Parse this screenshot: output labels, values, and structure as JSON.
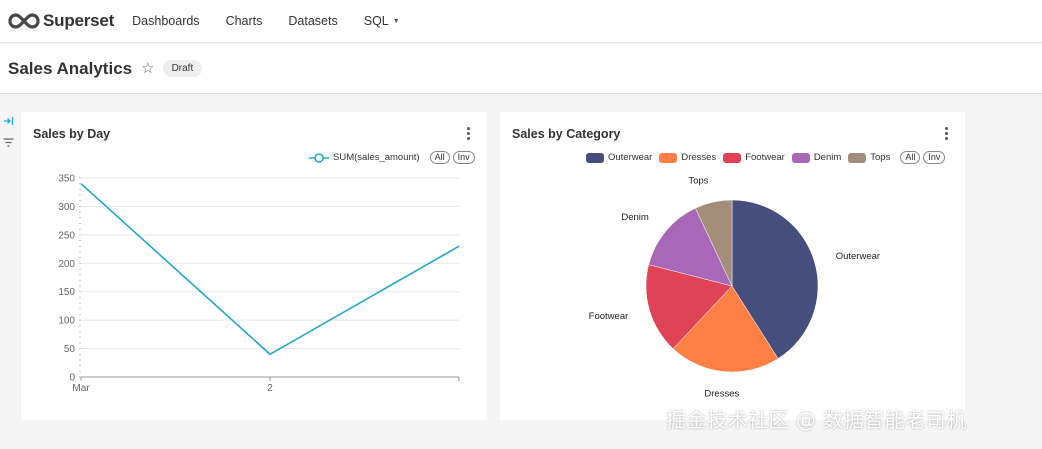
{
  "app": {
    "brand": "Superset"
  },
  "nav": {
    "items": [
      "Dashboards",
      "Charts",
      "Datasets",
      "SQL"
    ]
  },
  "header": {
    "title": "Sales Analytics",
    "status": "Draft"
  },
  "colors": {
    "line": "#1fa8c9",
    "outerwear": "#454e7c",
    "dresses": "#ff7f44",
    "footwear": "#e04355",
    "denim": "#a868b7",
    "tops": "#a38f79",
    "brand": "#484848"
  },
  "charts": [
    {
      "title": "Sales by Day",
      "legend": {
        "series": "SUM(sales_amount)",
        "all": "All",
        "inv": "Inv"
      },
      "icons": [
        "menu-icon"
      ]
    },
    {
      "title": "Sales by Category",
      "legend": {
        "all": "All",
        "inv": "Inv"
      },
      "icons": [
        "menu-icon"
      ]
    }
  ],
  "chart_data": [
    {
      "type": "line",
      "title": "Sales by Day",
      "categories": [
        "Mar",
        "2",
        ""
      ],
      "series": [
        {
          "name": "SUM(sales_amount)",
          "values": [
            340,
            40,
            230
          ]
        }
      ],
      "yticks": [
        0,
        50,
        100,
        150,
        200,
        250,
        300,
        350
      ],
      "ylim": [
        0,
        350
      ],
      "grid": true,
      "legend": "top-right"
    },
    {
      "type": "pie",
      "title": "Sales by Category",
      "categories": [
        "Outerwear",
        "Dresses",
        "Footwear",
        "Denim",
        "Tops"
      ],
      "values": [
        41,
        21,
        17,
        14,
        7
      ],
      "legend": "top"
    }
  ],
  "watermark": "掘金技术社区 @ 数据智能老司机"
}
